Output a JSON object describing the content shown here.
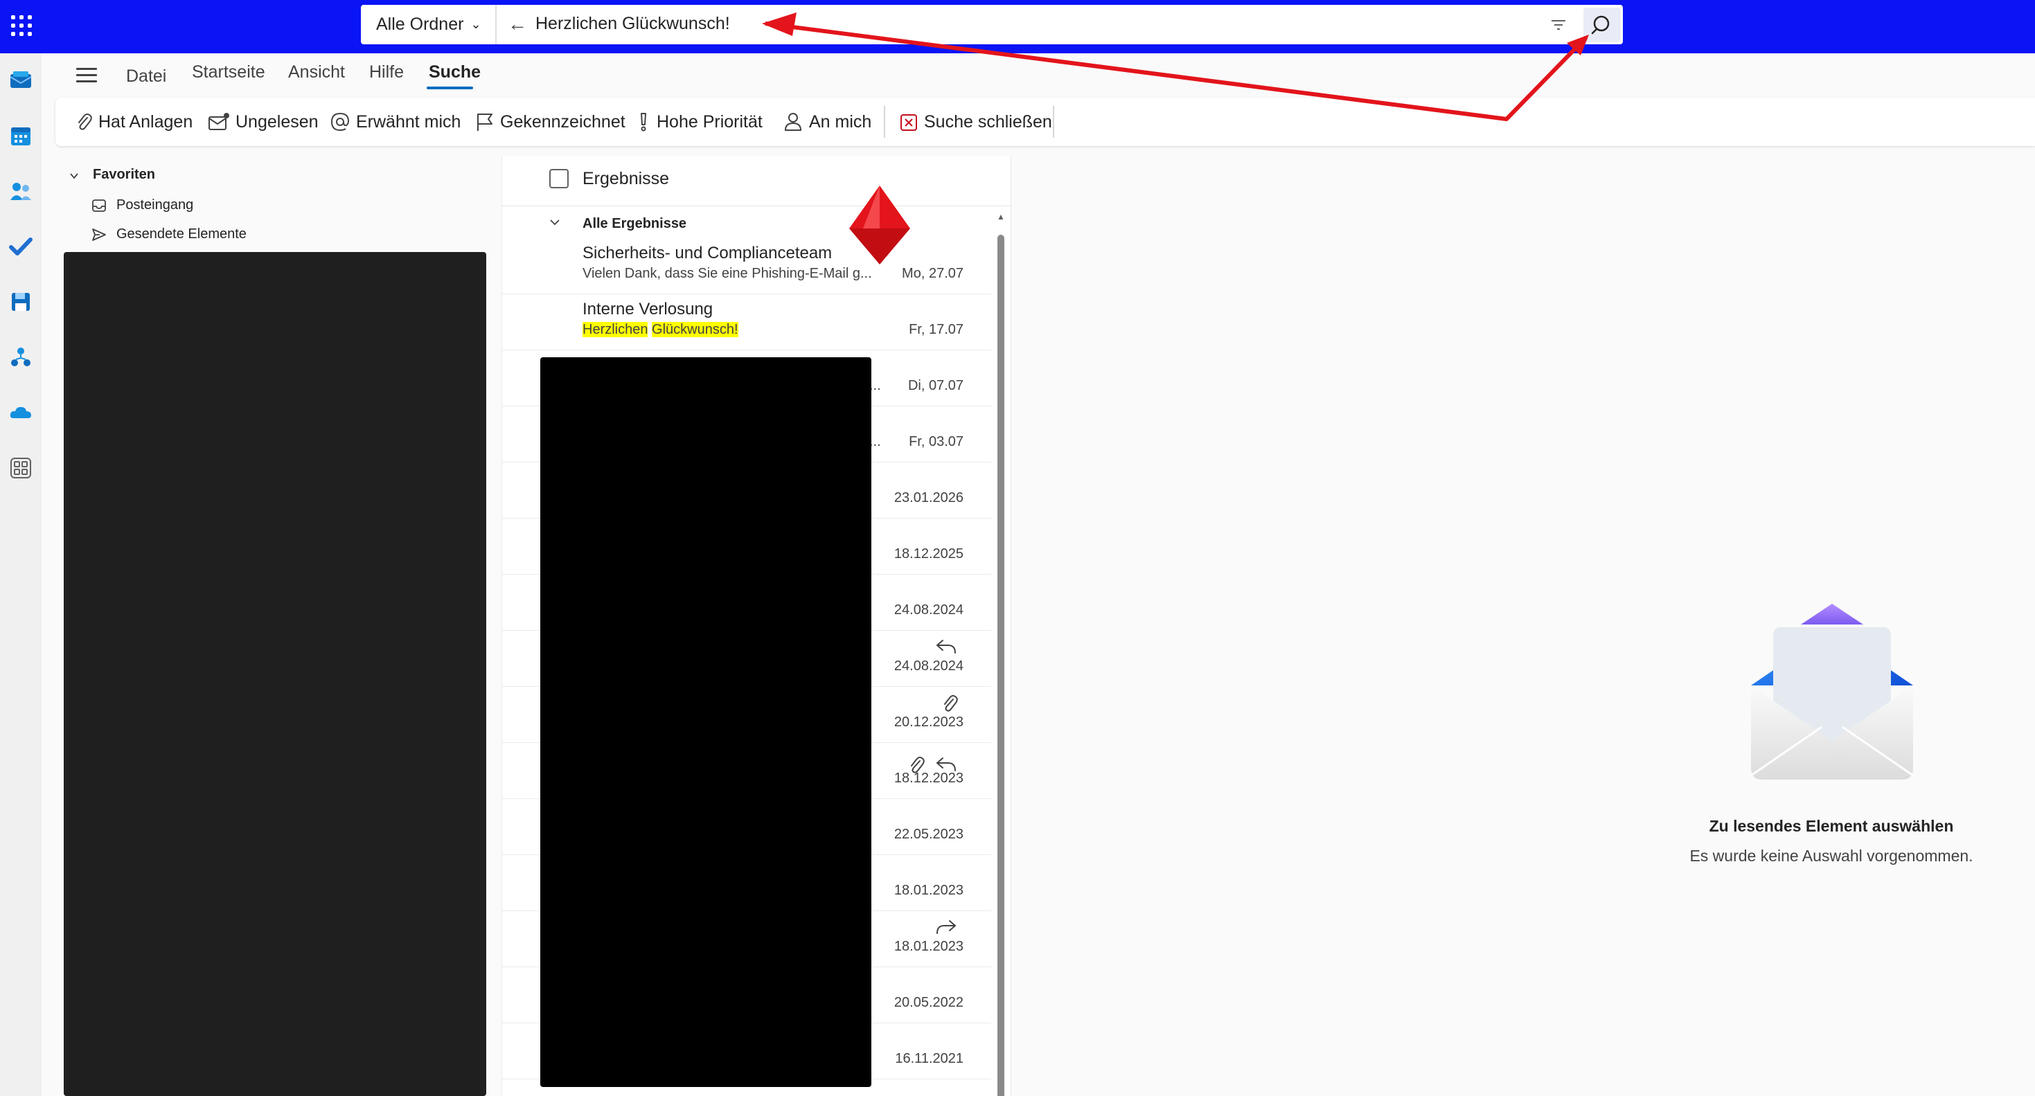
{
  "search": {
    "scope_label": "Alle Ordner",
    "query": "Herzlichen Glückwunsch!"
  },
  "menu": {
    "tabs": [
      "Datei",
      "Startseite",
      "Ansicht",
      "Hilfe",
      "Suche"
    ],
    "active_tab": "Suche"
  },
  "ribbon": {
    "filters": [
      {
        "label": "Hat Anlagen",
        "icon": "paperclip-icon"
      },
      {
        "label": "Ungelesen",
        "icon": "unread-mail-icon"
      },
      {
        "label": "Erwähnt mich",
        "icon": "at-icon"
      },
      {
        "label": "Gekennzeichnet",
        "icon": "flag-icon"
      },
      {
        "label": "Hohe Priorität",
        "icon": "exclamation-icon"
      },
      {
        "label": "An mich",
        "icon": "person-icon"
      }
    ],
    "close_search": "Suche schließen"
  },
  "folders": {
    "group_label": "Favoriten",
    "items": [
      {
        "label": "Posteingang",
        "icon": "inbox-icon"
      },
      {
        "label": "Gesendete Elemente",
        "icon": "send-icon"
      }
    ]
  },
  "list": {
    "header": "Ergebnisse",
    "group": "Alle Ergebnisse",
    "rows": [
      {
        "sender": "Sicherheits- und Complianceteam",
        "preview": "Vielen Dank, dass Sie eine Phishing-E-Mail g...",
        "date": "Mo, 27.07"
      },
      {
        "sender": "Interne Verlosung",
        "preview_parts": [
          "Herzlichen",
          "Glückwunsch!"
        ],
        "date": "Fr, 17.07"
      },
      {
        "date": "Di, 07.07",
        "trailing": "..."
      },
      {
        "date": "Fr, 03.07",
        "trailing": "..."
      },
      {
        "date": "23.01.2026"
      },
      {
        "date": "18.12.2025"
      },
      {
        "date": "24.08.2024"
      },
      {
        "date": "24.08.2024",
        "status_icons": [
          "reply-icon"
        ]
      },
      {
        "date": "20.12.2023",
        "status_icons": [
          "paperclip-icon"
        ]
      },
      {
        "date": "18.12.2023",
        "status_icons": [
          "paperclip-icon",
          "reply-icon"
        ]
      },
      {
        "date": "22.05.2023"
      },
      {
        "date": "18.01.2023"
      },
      {
        "date": "18.01.2023",
        "status_icons": [
          "forward-icon"
        ]
      },
      {
        "date": "20.05.2022"
      },
      {
        "date": "16.11.2021"
      }
    ]
  },
  "reading_pane": {
    "title": "Zu lesendes Element auswählen",
    "subtitle": "Es wurde keine Auswahl vorgenommen."
  },
  "colors": {
    "topbar": "#0a14f5",
    "accent": "#0f6cbd",
    "highlight": "#ffff00",
    "annotation": "#e3141b"
  }
}
